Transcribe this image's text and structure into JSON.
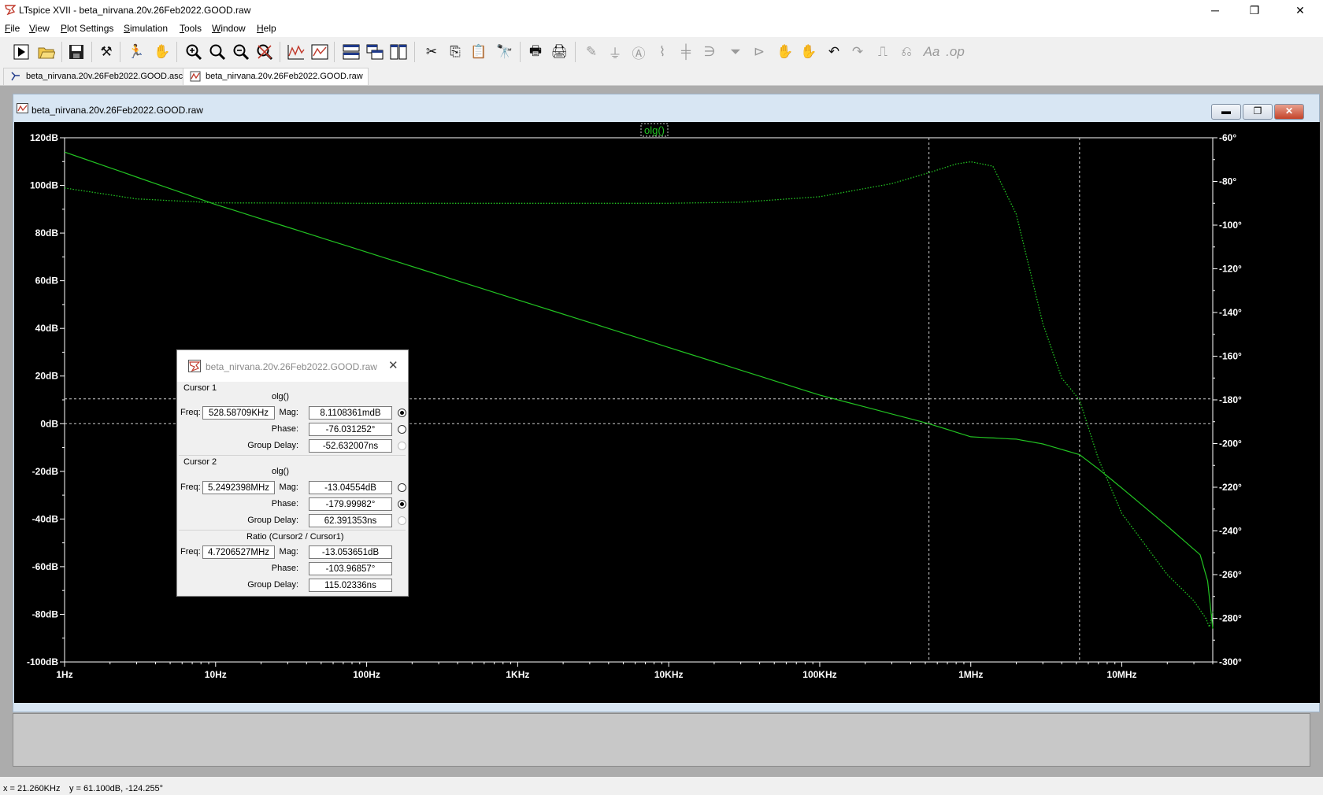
{
  "window": {
    "title": "LTspice XVII - beta_nirvana.20v.26Feb2022.GOOD.raw",
    "minimize": "─",
    "restore": "❐",
    "close": "✕"
  },
  "menu": [
    "File",
    "View",
    "Plot Settings",
    "Simulation",
    "Tools",
    "Window",
    "Help"
  ],
  "toolbar_icons": [
    "run-icon",
    "open-icon",
    "save-icon",
    "control-panel-icon",
    "halt-icon",
    "pan-icon",
    "zoom-in-icon",
    "zoom-area-icon",
    "zoom-out-icon",
    "zoom-fit-icon",
    "autorange-icon",
    "plot-settings-icon",
    "tile-horizontal-icon",
    "cascade-icon",
    "tile-vertical-icon",
    "cut-icon",
    "copy-icon",
    "paste-icon",
    "find-icon",
    "print-preview-icon",
    "print-icon",
    "wire-icon",
    "ground-icon",
    "label-icon",
    "resistor-icon",
    "capacitor-icon",
    "inductor-icon",
    "diode-icon",
    "component-icon",
    "move-icon",
    "drag-icon",
    "undo-icon",
    "redo-icon",
    "rotate-icon",
    "mirror-icon",
    "text-icon",
    "spice-directive-icon"
  ],
  "tabs": [
    {
      "label": "beta_nirvana.20v.26Feb2022.GOOD.asc",
      "active": false
    },
    {
      "label": "beta_nirvana.20v.26Feb2022.GOOD.raw",
      "active": true
    }
  ],
  "child_window": {
    "title": "beta_nirvana.20v.26Feb2022.GOOD.raw"
  },
  "chart_data": {
    "type": "line",
    "title": "olg()",
    "x_scale": "log",
    "xlim": [
      1,
      40000000
    ],
    "x_ticks": [
      {
        "v": 1,
        "label": "1Hz"
      },
      {
        "v": 10,
        "label": "10Hz"
      },
      {
        "v": 100,
        "label": "100Hz"
      },
      {
        "v": 1000,
        "label": "1KHz"
      },
      {
        "v": 10000,
        "label": "10KHz"
      },
      {
        "v": 100000,
        "label": "100KHz"
      },
      {
        "v": 1000000,
        "label": "1MHz"
      },
      {
        "v": 10000000,
        "label": "10MHz"
      }
    ],
    "y_left": {
      "min": -100,
      "max": 120,
      "ticks": [
        "120dB",
        "100dB",
        "80dB",
        "60dB",
        "40dB",
        "20dB",
        "0dB",
        "-20dB",
        "-40dB",
        "-60dB",
        "-80dB",
        "-100dB"
      ]
    },
    "y_right": {
      "min": -300,
      "max": -60,
      "ticks": [
        "-60°",
        "-80°",
        "-100°",
        "-120°",
        "-140°",
        "-160°",
        "-180°",
        "-200°",
        "-220°",
        "-240°",
        "-260°",
        "-280°",
        "-300°"
      ]
    },
    "grid": false,
    "colors": {
      "background": "#000000",
      "trace": "#22c322",
      "axes": "#ffffff",
      "cursor": "#d0d0d0"
    },
    "series": [
      {
        "name": "olg() magnitude",
        "style": "solid",
        "axis": "left",
        "unit": "dB",
        "points": [
          [
            1,
            114
          ],
          [
            10,
            92
          ],
          [
            100,
            72
          ],
          [
            1000,
            52
          ],
          [
            10000,
            32
          ],
          [
            100000,
            12
          ],
          [
            528587,
            0
          ],
          [
            1000000,
            -5.5
          ],
          [
            2000000,
            -6.5
          ],
          [
            3000000,
            -8.5
          ],
          [
            5249240,
            -13
          ],
          [
            7000000,
            -19
          ],
          [
            10000000,
            -27
          ],
          [
            20000000,
            -43
          ],
          [
            33000000,
            -55
          ],
          [
            37000000,
            -66
          ],
          [
            40000000,
            -86
          ]
        ]
      },
      {
        "name": "olg() phase",
        "style": "dotted",
        "axis": "right",
        "unit": "°",
        "points": [
          [
            1,
            -83
          ],
          [
            3,
            -88
          ],
          [
            10,
            -89.8
          ],
          [
            100,
            -90
          ],
          [
            1000,
            -90
          ],
          [
            10000,
            -90
          ],
          [
            30000,
            -89.5
          ],
          [
            100000,
            -87
          ],
          [
            300000,
            -81
          ],
          [
            528587,
            -76
          ],
          [
            800000,
            -72
          ],
          [
            1000000,
            -71
          ],
          [
            1400000,
            -73
          ],
          [
            2000000,
            -95
          ],
          [
            3000000,
            -145
          ],
          [
            4000000,
            -170
          ],
          [
            5249240,
            -180
          ],
          [
            7000000,
            -207
          ],
          [
            10000000,
            -232
          ],
          [
            20000000,
            -260
          ],
          [
            30000000,
            -272
          ],
          [
            36000000,
            -280
          ],
          [
            38000000,
            -284
          ],
          [
            40000000,
            -277
          ]
        ]
      }
    ],
    "cursors": {
      "cursor1_freq": 528587,
      "cursor2_freq": 5249240,
      "h_lines_db": [
        0,
        10.4
      ]
    }
  },
  "cursor_dialog": {
    "title": "beta_nirvana.20v.26Feb2022.GOOD.raw",
    "close": "✕",
    "cursor1": {
      "heading": "Cursor 1",
      "trace": "olg()",
      "freq_label": "Freq:",
      "freq": "528.58709KHz",
      "mag_label": "Mag:",
      "mag": "8.1108361mdB",
      "phase_label": "Phase:",
      "phase": "-76.031252°",
      "gd_label": "Group Delay:",
      "gd": "-52.632007ns"
    },
    "cursor2": {
      "heading": "Cursor 2",
      "trace": "olg()",
      "freq_label": "Freq:",
      "freq": "5.2492398MHz",
      "mag_label": "Mag:",
      "mag": "-13.04554dB",
      "phase_label": "Phase:",
      "phase": "-179.99982°",
      "gd_label": "Group Delay:",
      "gd": "62.391353ns"
    },
    "ratio": {
      "heading": "Ratio (Cursor2 / Cursor1)",
      "freq_label": "Freq:",
      "freq": "4.7206527MHz",
      "mag_label": "Mag:",
      "mag": "-13.053651dB",
      "phase_label": "Phase:",
      "phase": "-103.96857°",
      "gd_label": "Group Delay:",
      "gd": "115.02336ns"
    }
  },
  "status": {
    "x": "x = 21.260KHz",
    "y": "y = 61.100dB, -124.255°"
  }
}
